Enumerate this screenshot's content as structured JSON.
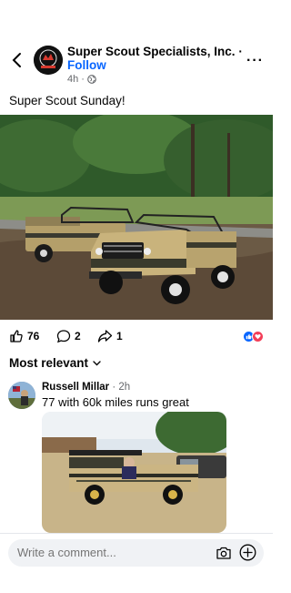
{
  "post": {
    "page_name": "Super Scout Specialists, Inc.",
    "separator": " · ",
    "follow_label": "Follow",
    "time": "4h",
    "visibility_icon": "globe-icon",
    "caption": "Super Scout Sunday!"
  },
  "stats": {
    "likes": "76",
    "comments": "2",
    "shares": "1",
    "reaction_icons": [
      "like-icon",
      "love-icon"
    ],
    "colors": {
      "like": "#0866ff",
      "love": "#f33e58"
    }
  },
  "comments_section": {
    "sort_label": "Most relevant",
    "comment": {
      "author": "Russell Millar",
      "time": " · 2h",
      "text": "77 with 60k miles runs great"
    }
  },
  "composer": {
    "placeholder": "Write a comment..."
  },
  "colors": {
    "accent": "#0866ff",
    "secondary_text": "#65676b"
  }
}
